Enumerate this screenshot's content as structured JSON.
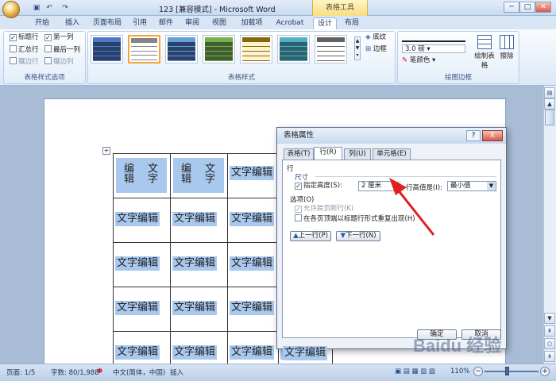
{
  "window": {
    "title": "123 [兼容模式] - Microsoft Word",
    "context_tab": "表格工具"
  },
  "qa": {
    "undo": "↶",
    "redo": "↷",
    "save": "▣"
  },
  "tabs": [
    "开始",
    "插入",
    "页面布局",
    "引用",
    "邮件",
    "审阅",
    "视图",
    "加载项",
    "Acrobat",
    "设计",
    "布局"
  ],
  "ribbon": {
    "options_group": "表格样式选项",
    "checks": [
      {
        "label": "标题行",
        "checked": true
      },
      {
        "label": "第一列",
        "checked": true
      },
      {
        "label": "汇总行",
        "checked": false
      },
      {
        "label": "最后一列",
        "checked": false
      },
      {
        "label": "镶边行",
        "checked": false,
        "dim": true
      },
      {
        "label": "镶边列",
        "checked": false,
        "dim": true
      }
    ],
    "styles_group": "表格样式",
    "shading": "底纹",
    "border": "边框",
    "draw_group": "绘图边框",
    "pen_weight": "3.0 磅",
    "pen_color": "笔颜色",
    "draw_table": "绘制表格",
    "eraser": "擦除"
  },
  "doc": {
    "cell_text": "文字编辑",
    "vertical_left": "编辑",
    "vertical_right": "文字"
  },
  "dialog": {
    "title": "表格属性",
    "help": "?",
    "close": "X",
    "tabs": [
      "表格(T)",
      "行(R)",
      "列(U)",
      "单元格(E)"
    ],
    "section_row": "行",
    "size_label": "尺寸",
    "specify_height": "指定高度(S):",
    "height_value": "2 厘米",
    "row_height_is": "行高值是(I):",
    "row_height_mode": "最小值",
    "options": "选项(O)",
    "allow_break": "允许跨页断行(K)",
    "repeat_header": "在各页顶端以标题行形式重复出现(H)",
    "prev_row": "上一行(P)",
    "next_row": "下一行(N)",
    "ok": "确定",
    "cancel": "取消"
  },
  "status": {
    "page": "页面: 1/5",
    "words": "字数: 80/1,988",
    "lang": "中文(简体，中国)",
    "mode": "插入",
    "zoom": "110%"
  },
  "watermark": "Baidu 经验"
}
